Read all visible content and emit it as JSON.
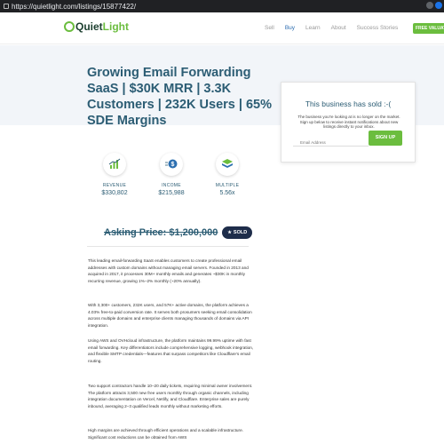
{
  "browser": {
    "url": "https://quietlight.com/listings/15877422/"
  },
  "header": {
    "logo_q": "Quiet",
    "logo_light": "Light",
    "nav": [
      "Sell",
      "Buy",
      "Learn",
      "About",
      "Success Stories"
    ],
    "free_valuation": "FREE VALUATI"
  },
  "listing": {
    "title": "Growing Email Forwarding SaaS | $30K MRR | 3.3K Customers | 232K Users | 65% SDE Margins",
    "asking_price": "Asking Price: $1,200,000",
    "sold_badge": "SOLD"
  },
  "sold_card": {
    "heading": "This business has sold :-(",
    "text": "The business you're looking at is no longer on the market. Sign up below to receive instant notifications about new listings directly to your inbox.",
    "email_placeholder": "Email Address",
    "signup_label": "SIGN UP"
  },
  "stats": [
    {
      "label": "REVENUE",
      "value": "$330,802",
      "icon": "bar-chart-icon"
    },
    {
      "label": "INCOME",
      "value": "$215,988",
      "icon": "dollar-icon"
    },
    {
      "label": "MULTIPLE",
      "value": "5.56x",
      "icon": "layers-icon"
    }
  ],
  "description": [
    "This leading email-forwarding SaaS enables customers to create professional email addresses with custom domains without managing email servers. Founded in 2013 and acquired in 2017, it processes 30M+ monthly emails and generates ~$30K in monthly recurring revenue, growing 1%–2% monthly (~20% annually).",
    "With 3,300+ customers, 232K users, and 57K+ active domains, the platform achieves a 4.03% free-to-paid conversion rate. It serves both prosumers seeking email consolidation across multiple domains and enterprise clients managing thousands of domains via API integration.",
    "Using AWS and OVHcloud infrastructure, the platform maintains 99.99% uptime with fast email forwarding. Key differentiators include comprehensive logging, webhook integration, and flexible SMTP credentials—features that surpass competitors like Cloudflare's email routing.",
    "Two support contractors handle 10–20 daily tickets, requiring minimal owner involvement. The platform attracts 3,500 new free users monthly through organic channels, including integration documentation on Vercel, Netlify, and Cloudflare. Enterprise sales are purely inbound, averaging 2–3 qualified leads monthly without marketing efforts.",
    "High margins are achieved through efficient operations and a scalable infrastructure. Significant cost reductions can be obtained from AWS"
  ],
  "colors": {
    "accent_green": "#6bbd3e",
    "title_blue": "#2c5d74",
    "badge_navy": "#1e2d4a"
  }
}
